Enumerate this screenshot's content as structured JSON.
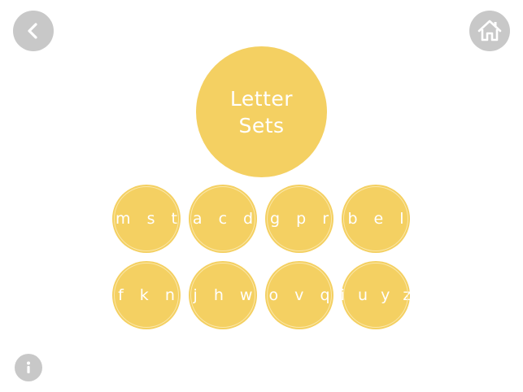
{
  "header": {
    "back_icon": "chevron-left-icon",
    "home_icon": "home-icon"
  },
  "title": {
    "line1": "Letter",
    "line2": "Sets"
  },
  "letter_sets": [
    {
      "label": "m s t"
    },
    {
      "label": "a c d"
    },
    {
      "label": "g p r"
    },
    {
      "label": "b e l"
    },
    {
      "label": "f k n"
    },
    {
      "label": "j h w"
    },
    {
      "label": "o v q"
    },
    {
      "label": "i u y z"
    }
  ],
  "footer": {
    "info_icon": "info-icon"
  },
  "colors": {
    "accent": "#f4d062",
    "nav_button": "#c8c8c8",
    "text": "#ffffff"
  }
}
